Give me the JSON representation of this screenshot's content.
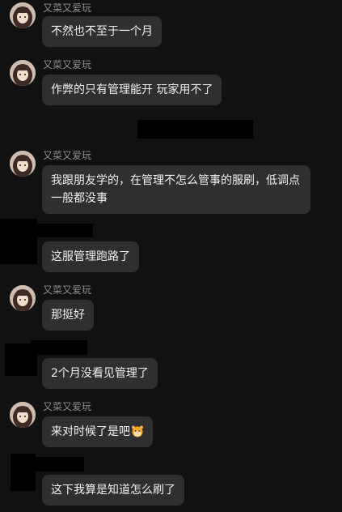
{
  "user_name": "又菜又爱玩",
  "messages": [
    {
      "text": "不然也不至于一个月"
    },
    {
      "text": "作弊的只有管理能开 玩家用不了"
    },
    {
      "text": "我跟朋友学的，在管理不怎么管事的服刷，低调点一般都没事"
    },
    {
      "text": "这服管理跑路了"
    },
    {
      "text": "那挺好"
    },
    {
      "text": "2个月没看见管理了"
    },
    {
      "text": "来对时候了是吧",
      "emoji": "hamster-face-emoji"
    },
    {
      "text": "这下我算是知道怎么刷了"
    }
  ]
}
